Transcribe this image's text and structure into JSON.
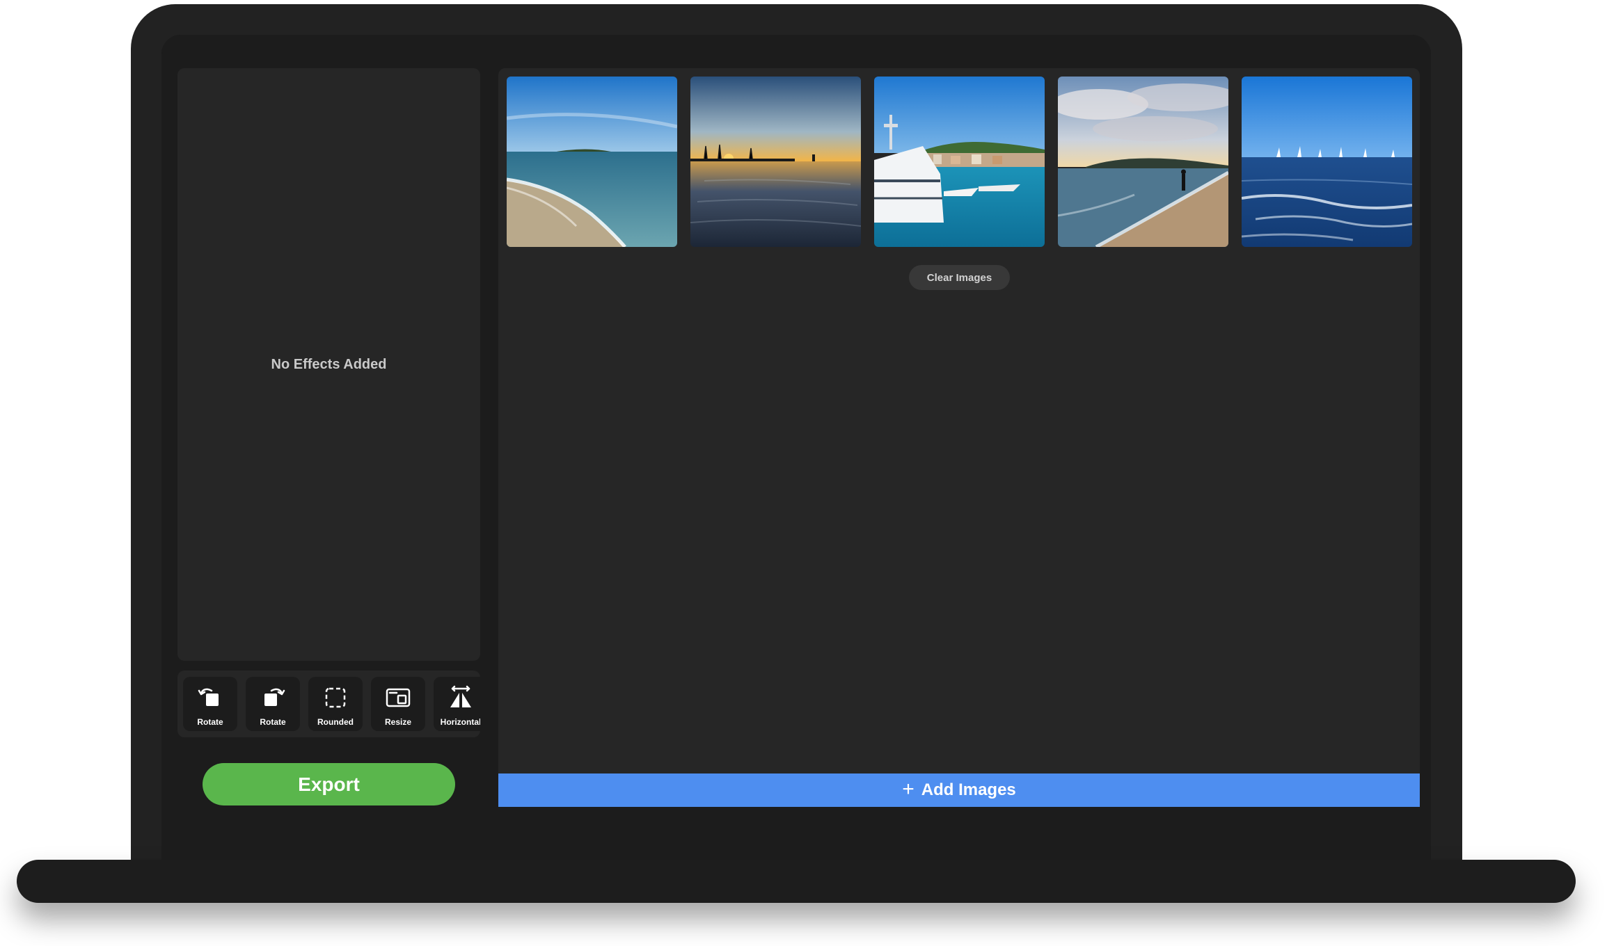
{
  "colors": {
    "export_green": "#5ab64c",
    "add_blue": "#4e8ef0",
    "panel_bg": "#262626",
    "screen_bg": "#1c1c1c"
  },
  "effects_panel": {
    "empty_text": "No Effects Added"
  },
  "tools": [
    {
      "label": "Rotate",
      "icon": "rotate-left-icon"
    },
    {
      "label": "Rotate",
      "icon": "rotate-right-icon"
    },
    {
      "label": "Rounded",
      "icon": "rounded-corners-icon"
    },
    {
      "label": "Resize",
      "icon": "resize-icon"
    },
    {
      "label": "Horizontal",
      "icon": "flip-horizontal-icon"
    }
  ],
  "export_label": "Export",
  "images": [
    {
      "subject": "beach-shoreline"
    },
    {
      "subject": "harbor-sunset"
    },
    {
      "subject": "yacht-marina"
    },
    {
      "subject": "beach-person"
    },
    {
      "subject": "sea-sailboats"
    }
  ],
  "clear_label": "Clear Images",
  "add_images_label": "Add Images"
}
